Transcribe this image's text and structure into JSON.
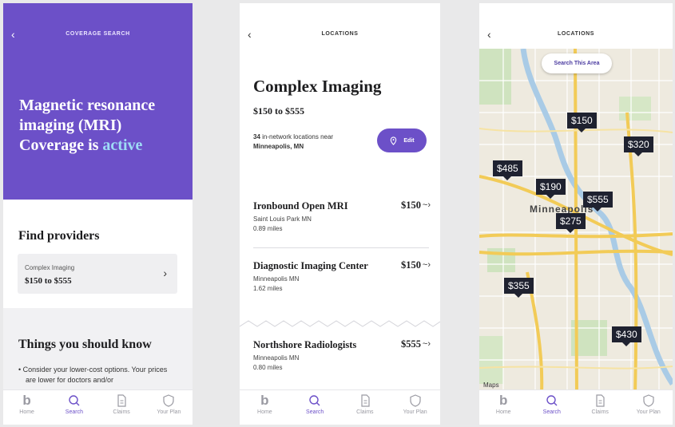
{
  "screen1": {
    "nav_title": "COVERAGE SEARCH",
    "hero": {
      "line1": "Magnetic resonance imaging (MRI) Coverage is",
      "active_word": "active"
    },
    "find_providers": "Find providers",
    "card": {
      "label": "Complex Imaging",
      "range": "$150 to $555"
    },
    "things_title": "Things you should know",
    "things_body": "• Consider your lower-cost options. Your prices are lower for doctors and/or"
  },
  "screen2": {
    "nav_title": "LOCATIONS",
    "title": "Complex Imaging",
    "range": "$150 to $555",
    "count_text": "in-network locations near",
    "count_number": "34",
    "near_city": "Minneapolis, MN",
    "edit_label": "Edit",
    "rows": [
      {
        "name": "Ironbound Open MRI",
        "city": "Saint Louis Park MN",
        "distance": "0.89 miles",
        "price": "$150"
      },
      {
        "name": "Diagnostic Imaging Center",
        "city": "Minneapolis MN",
        "distance": "1.62 miles",
        "price": "$150"
      },
      {
        "name": "Northshore Radiologists",
        "city": "Minneapolis MN",
        "distance": "0.80 miles",
        "price": "$555"
      }
    ]
  },
  "screen3": {
    "nav_title": "LOCATIONS",
    "search_area": "Search This Area",
    "city_label": "Minneapolis",
    "attribution": "Maps",
    "pins": [
      "$150",
      "$320",
      "$485",
      "$190",
      "$555",
      "$275",
      "$355",
      "$430"
    ]
  },
  "tabs": [
    {
      "label": "Home",
      "icon": "b-logo-icon"
    },
    {
      "label": "Search",
      "icon": "search-icon"
    },
    {
      "label": "Claims",
      "icon": "document-icon"
    },
    {
      "label": "Your Plan",
      "icon": "shield-icon"
    }
  ],
  "colors": {
    "brand_purple": "#6c50c8",
    "active_text": "#9edcf6",
    "pin_bg": "#1f2230"
  }
}
